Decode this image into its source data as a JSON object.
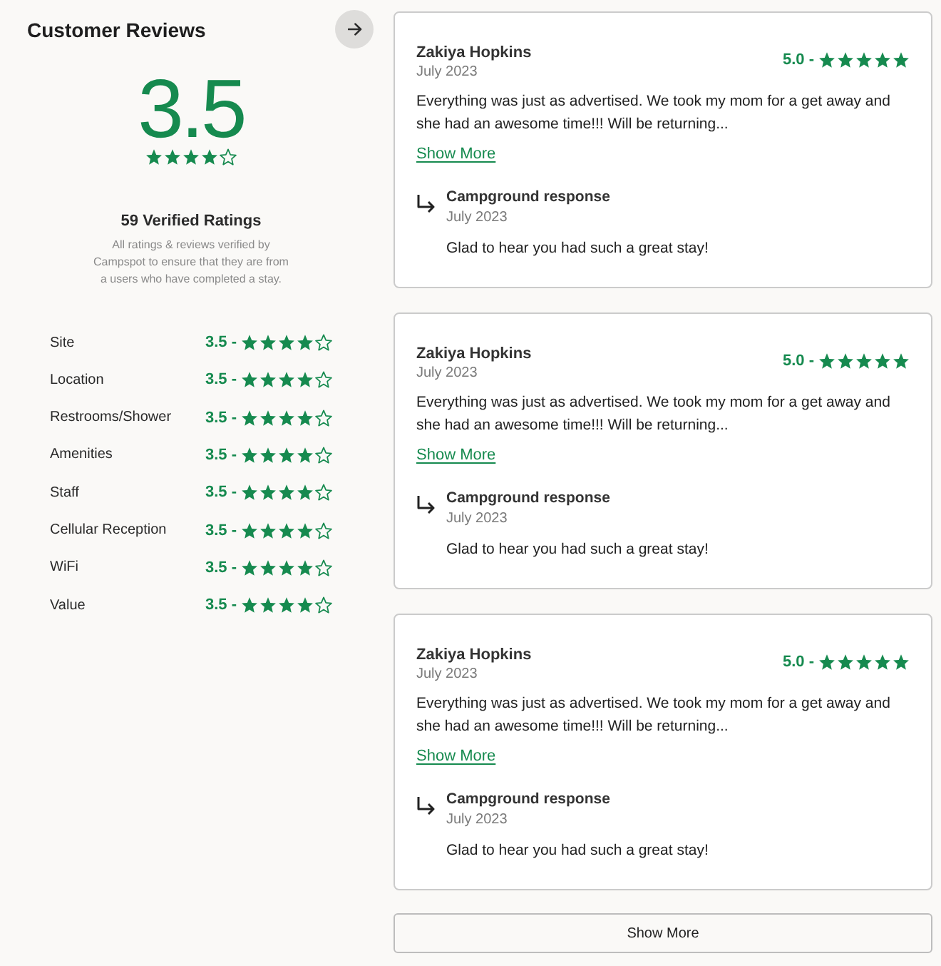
{
  "summary": {
    "title": "Customer Reviews",
    "overall_rating": "3.5",
    "stars": 4,
    "ratings_count": "59 Verified Ratings",
    "disclaimer": "All ratings & reviews verified by Campspot to ensure that they are from a users who have completed a stay.",
    "categories": [
      {
        "label": "Site",
        "score": "3.5 -",
        "stars": 4
      },
      {
        "label": "Location",
        "score": "3.5 -",
        "stars": 4
      },
      {
        "label": "Restrooms/Shower",
        "score": "3.5 -",
        "stars": 4
      },
      {
        "label": "Amenities",
        "score": "3.5 -",
        "stars": 4
      },
      {
        "label": "Staff",
        "score": "3.5 -",
        "stars": 4
      },
      {
        "label": "Cellular Reception",
        "score": "3.5 -",
        "stars": 4
      },
      {
        "label": "WiFi",
        "score": "3.5 -",
        "stars": 4
      },
      {
        "label": "Value",
        "score": "3.5 -",
        "stars": 4
      }
    ]
  },
  "reviews": [
    {
      "author": "Zakiya Hopkins",
      "date": "July 2023",
      "score": "5.0 -",
      "stars": 5,
      "text": "Everything was just as advertised. We took my mom for a get away and she had an awesome time!!! Will be returning...",
      "show_more": "Show More",
      "response": {
        "title": "Campground response",
        "date": "July 2023",
        "text": "Glad to hear you had such a great stay!"
      }
    },
    {
      "author": "Zakiya Hopkins",
      "date": "July 2023",
      "score": "5.0 -",
      "stars": 5,
      "text": "Everything was just as advertised. We took my mom for a get away and she had an awesome time!!! Will be returning...",
      "show_more": "Show More",
      "response": {
        "title": "Campground response",
        "date": "July 2023",
        "text": "Glad to hear you had such a great stay!"
      }
    },
    {
      "author": "Zakiya Hopkins",
      "date": "July 2023",
      "score": "5.0 -",
      "stars": 5,
      "text": "Everything was just as advertised. We took my mom for a get away and she had an awesome time!!! Will be returning...",
      "show_more": "Show More",
      "response": {
        "title": "Campground response",
        "date": "July 2023",
        "text": "Glad to hear you had such a great stay!"
      }
    }
  ],
  "show_more_button": "Show More"
}
